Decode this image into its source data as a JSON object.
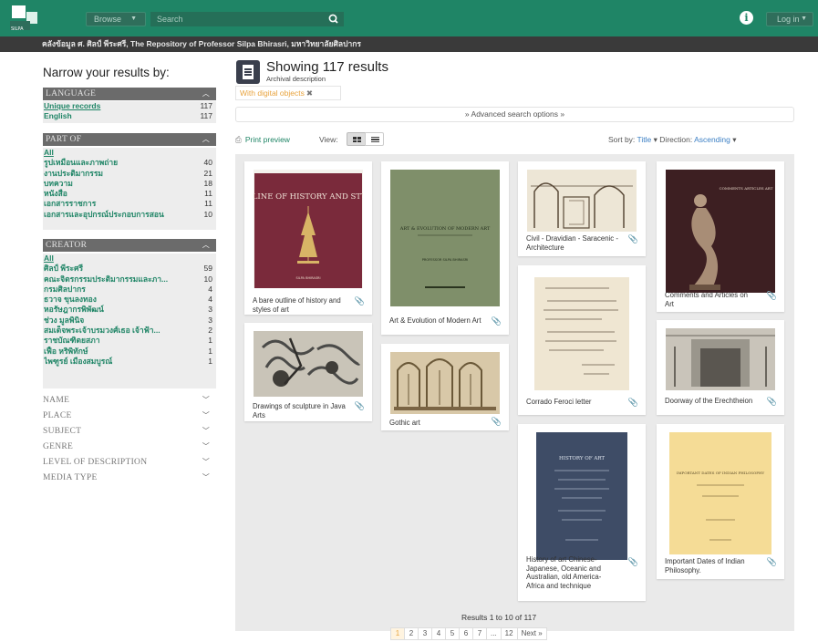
{
  "topbar": {
    "browse_label": "Browse",
    "search_placeholder": "Search",
    "login_label": "Log in"
  },
  "breadcrumb": "คลังข้อมูล ศ. ศิลป์ พีระศรี, The Repository of Professor Silpa Bhirasri, มหาวิทยาลัยศิลปากร",
  "sidebar": {
    "title": "Narrow your results by:",
    "language": {
      "heading": "LANGUAGE",
      "items": [
        {
          "label": "Unique records",
          "count": "117"
        },
        {
          "label": "English",
          "count": "117"
        }
      ]
    },
    "part_of": {
      "heading": "PART OF",
      "items": [
        {
          "label": "All",
          "count": ""
        },
        {
          "label": "รูปเหมือนและภาพถ่าย",
          "count": "40"
        },
        {
          "label": "งานประติมากรรม",
          "count": "21"
        },
        {
          "label": "บทความ",
          "count": "18"
        },
        {
          "label": "หนังสือ",
          "count": "11"
        },
        {
          "label": "เอกสารราชการ",
          "count": "11"
        },
        {
          "label": "เอกสารและอุปกรณ์ประกอบการสอน",
          "count": "10"
        }
      ]
    },
    "creator": {
      "heading": "CREATOR",
      "items": [
        {
          "label": "All",
          "count": ""
        },
        {
          "label": "ศิลป์ พีระศรี",
          "count": "59"
        },
        {
          "label": "คณะจิตรกรรมประติมากรรมและภา...",
          "count": "10"
        },
        {
          "label": "กรมศิลปากร",
          "count": "4"
        },
        {
          "label": "ธวาจ ขุนลงทอง",
          "count": "4"
        },
        {
          "label": "หอรัษฎากรพิพัฒน์",
          "count": "3"
        },
        {
          "label": "ช่วง มูลพินิจ",
          "count": "3"
        },
        {
          "label": "สมเด็จพระเจ้าบรมวงศ์เธอ เจ้าฟ้า...",
          "count": "2"
        },
        {
          "label": "ราชบัณฑิตยสภา",
          "count": "1"
        },
        {
          "label": "เฟื้อ หริพิทักษ์",
          "count": "1"
        },
        {
          "label": "ไพฑูรย์ เมืองสมบูรณ์",
          "count": "1"
        }
      ]
    },
    "collapsed": [
      "NAME",
      "PLACE",
      "SUBJECT",
      "GENRE",
      "LEVEL OF DESCRIPTION",
      "MEDIA TYPE"
    ]
  },
  "main": {
    "showing": "Showing 117 results",
    "subtitle": "Archival description",
    "digital_filter": "With digital objects",
    "advanced_search": "Advanced search options",
    "print_preview": "Print preview",
    "view_label": "View:",
    "sort_by_label": "Sort by:",
    "sort_by_value": "Title",
    "direction_label": "Direction:",
    "direction_value": "Ascending"
  },
  "cards": [
    {
      "title": "A bare outline of history and styles of art",
      "thumb_text": "A BARE OUTLINE OF HISTORY AND STYLES OF ART",
      "thumb_sub": "SILPA BHIRASRI"
    },
    {
      "title": "Drawings of sculpture in Java Arts"
    },
    {
      "title": "Art & Evolution of Modern Art",
      "thumb_text": "ART & EVOLUTION OF MODERN ART",
      "thumb_sub": "PROFESSOR SILPA BHIRASRI"
    },
    {
      "title": "Gothic art"
    },
    {
      "title": "Civil - Dravidian - Saracenic - Architecture"
    },
    {
      "title": "Corrado Feroci letter"
    },
    {
      "title": "History of art Chinese-Japanese, Oceanic and Australian, old America-Africa and technique",
      "thumb_text": "HISTORY OF ART"
    },
    {
      "title": "Comments and Articles on Art",
      "thumb_text": "COMMENTS ARTICLES ART"
    },
    {
      "title": "Doorway of the Erechtheion"
    },
    {
      "title": "Important Dates of Indian Philosophy.",
      "thumb_text": "IMPORTANT DATES OF INDIAN PHILOSOPHY"
    }
  ],
  "pagination": {
    "results_text": "Results 1 to 10 of 117",
    "pages": [
      "1",
      "2",
      "3",
      "4",
      "5",
      "6",
      "7",
      "...",
      "12",
      "Next »"
    ]
  },
  "colors": {
    "brand_green": "#1f8566",
    "accent_orange": "#e8a33d",
    "link_blue": "#3b7fc4"
  },
  "icons": [
    "logo-icon",
    "search-icon",
    "info-icon",
    "print-icon",
    "grid-view-icon",
    "list-view-icon",
    "chevron-up-icon",
    "chevron-down-icon",
    "paperclip-icon",
    "results-document-icon"
  ]
}
